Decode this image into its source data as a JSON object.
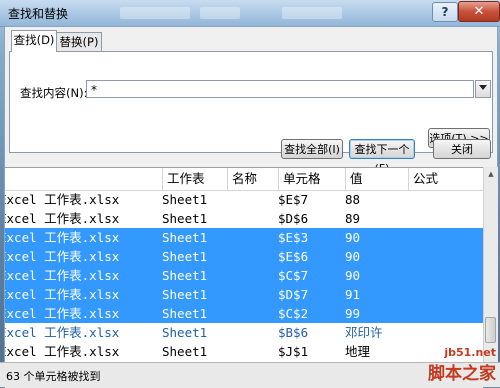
{
  "window": {
    "title": "查找和替换",
    "help_glyph": "?",
    "close_glyph": "✕"
  },
  "tabs": [
    {
      "label": "查找(D)",
      "active": true
    },
    {
      "label": "替换(P)",
      "active": false
    }
  ],
  "find": {
    "label": "查找内容(N):",
    "value": "*"
  },
  "buttons": {
    "options": "选项(T) >>",
    "find_all": "查找全部(I)",
    "find_next": "查找下一个(F)",
    "close": "关闭"
  },
  "results": {
    "columns": [
      "工作表",
      "名称",
      "单元格",
      "值",
      "公式"
    ],
    "rows": [
      {
        "book": "Excel 工作表.xlsx",
        "sheet": "Sheet1",
        "name": "",
        "cell": "$E$7",
        "value": "88",
        "formula": "",
        "state": "normal"
      },
      {
        "book": "Excel 工作表.xlsx",
        "sheet": "Sheet1",
        "name": "",
        "cell": "$D$6",
        "value": "89",
        "formula": "",
        "state": "normal"
      },
      {
        "book": "Excel 工作表.xlsx",
        "sheet": "Sheet1",
        "name": "",
        "cell": "$E$3",
        "value": "90",
        "formula": "",
        "state": "selected"
      },
      {
        "book": "Excel 工作表.xlsx",
        "sheet": "Sheet1",
        "name": "",
        "cell": "$E$6",
        "value": "90",
        "formula": "",
        "state": "selected"
      },
      {
        "book": "Excel 工作表.xlsx",
        "sheet": "Sheet1",
        "name": "",
        "cell": "$C$7",
        "value": "90",
        "formula": "",
        "state": "selected"
      },
      {
        "book": "Excel 工作表.xlsx",
        "sheet": "Sheet1",
        "name": "",
        "cell": "$D$7",
        "value": "91",
        "formula": "",
        "state": "selected"
      },
      {
        "book": "Excel 工作表.xlsx",
        "sheet": "Sheet1",
        "name": "",
        "cell": "$C$2",
        "value": "99",
        "formula": "",
        "state": "selected"
      },
      {
        "book": "Excel 工作表.xlsx",
        "sheet": "Sheet1",
        "name": "",
        "cell": "$B$6",
        "value": "邓印许",
        "formula": "",
        "state": "link"
      },
      {
        "book": "Excel 工作表.xlsx",
        "sheet": "Sheet1",
        "name": "",
        "cell": "$J$1",
        "value": "地理",
        "formula": "",
        "state": "normal"
      }
    ]
  },
  "status": {
    "text": "63 个单元格被找到"
  },
  "watermark": {
    "line1": "jb51.net",
    "line2": "脚本之家"
  }
}
